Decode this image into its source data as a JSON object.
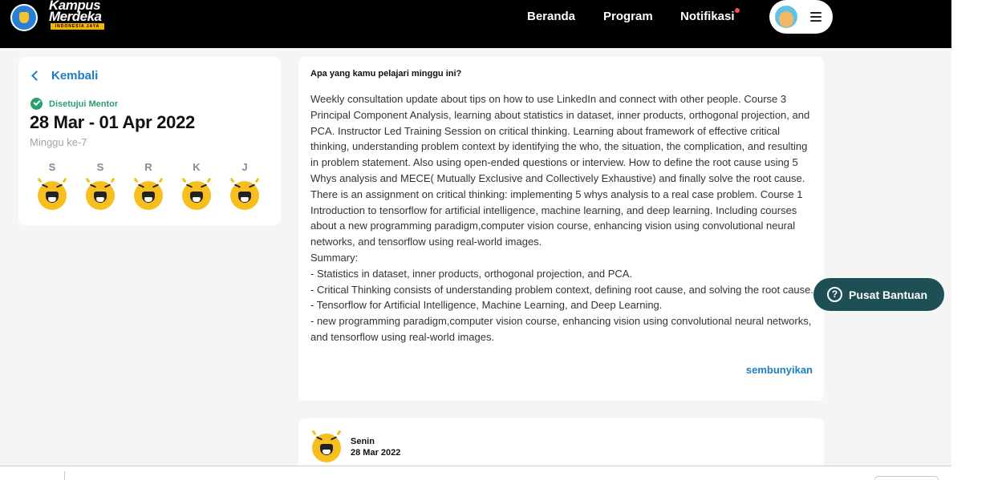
{
  "navbar": {
    "logo_line1": "Kampus",
    "logo_line2": "Merdeka",
    "logo_tagline": "INDONESIA JAYA",
    "links": [
      "Beranda",
      "Program",
      "Notifikasi"
    ],
    "notification_dot_color": "#ef5350",
    "menu_icon": "hamburger-icon"
  },
  "sidebar": {
    "back_label": "Kembali",
    "status_label": "Disetujui Mentor",
    "status_color": "#28a06a",
    "date_range": "28 Mar - 01 Apr 2022",
    "week_label": "Minggu ke-7",
    "days": [
      {
        "letter": "S",
        "mood": "laughing-face-icon"
      },
      {
        "letter": "S",
        "mood": "laughing-face-icon"
      },
      {
        "letter": "R",
        "mood": "laughing-face-icon"
      },
      {
        "letter": "K",
        "mood": "laughing-face-icon"
      },
      {
        "letter": "J",
        "mood": "laughing-face-icon"
      }
    ]
  },
  "report": {
    "question": "Apa yang kamu pelajari minggu ini?",
    "paragraphs": [
      "Weekly consultation update about tips on how to use LinkedIn and connect with other people. Course 3 Principal Component Analysis, learning about statistics in dataset, inner products, orthogonal projection, and PCA. Instructor Led Training Session on critical thinking. Learning about framework of effective critical thinking, understanding problem context by identifying the who, the situation, the complication, and resulting in problem statement. Also using open-ended questions or interview. How to define the root cause using 5 Whys analysis and MECE( Mutually Exclusive and Collectively Exhaustive) and finally solve the root cause. There is an assignment on critical thinking: implementing 5 whys analysis to a real case problem. Course 1 Introduction to tensorflow for artificial intelligence, machine learning, and deep learning. Including courses about a new programming paradigm,computer vision course, enhancing vision using convolutional neural networks, and tensorflow using real-world images.",
      "Summary:",
      "-    Statistics in dataset, inner products, orthogonal projection, and PCA.",
      "-    Critical Thinking consists of understanding problem context, defining root cause,  and solving the root cause.",
      "-    Tensorflow for Artificial Intelligence, Machine Learning, and Deep Learning.",
      "-    new programming paradigm,computer vision course, enhancing vision using convolutional neural networks, and tensorflow using real-world images."
    ],
    "hide_label": "sembunyikan",
    "link_color": "#1a7fc1"
  },
  "daily_entry": {
    "day": "Senin",
    "date": "28 Mar 2022",
    "mood": "laughing-face-icon"
  },
  "help_button": {
    "label": "Pusat Bantuan",
    "icon_glyph": "?",
    "color": "#1d4f55"
  }
}
